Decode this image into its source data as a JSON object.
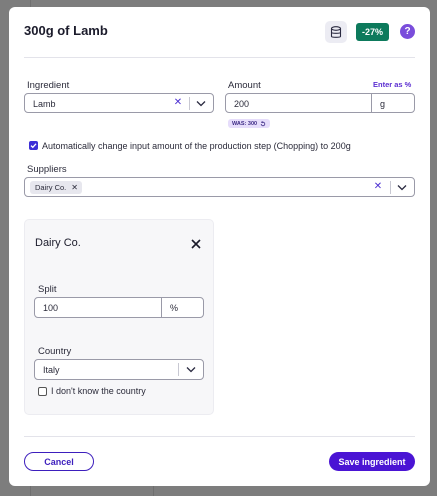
{
  "dialog": {
    "title": "300g of Lamb",
    "icons": {
      "database": "database-icon",
      "help": "help-icon"
    },
    "change_badge": "-27%",
    "help_glyph": "?",
    "colors": {
      "accent": "#4a14d4",
      "badge_bg": "#0d7a5c",
      "help_bg": "#7a4ddb"
    }
  },
  "ingredient": {
    "label": "Ingredient",
    "value": "Lamb"
  },
  "amount": {
    "label": "Amount",
    "enter_as_link": "Enter as %",
    "value": "200",
    "unit": "g",
    "was_badge": "WAS: 300"
  },
  "auto_change": {
    "checked": true,
    "label": "Automatically change input amount of the production step (Chopping) to 200g"
  },
  "suppliers": {
    "label": "Suppliers",
    "chips": [
      "Dairy Co."
    ]
  },
  "supplier_card": {
    "name": "Dairy Co.",
    "split": {
      "label": "Split",
      "value": "100",
      "unit": "%"
    },
    "country": {
      "label": "Country",
      "value": "Italy"
    },
    "unknown_country": {
      "checked": false,
      "label": "I don't know the country"
    }
  },
  "footer": {
    "cancel_label": "Cancel",
    "save_label": "Save ingredient"
  }
}
